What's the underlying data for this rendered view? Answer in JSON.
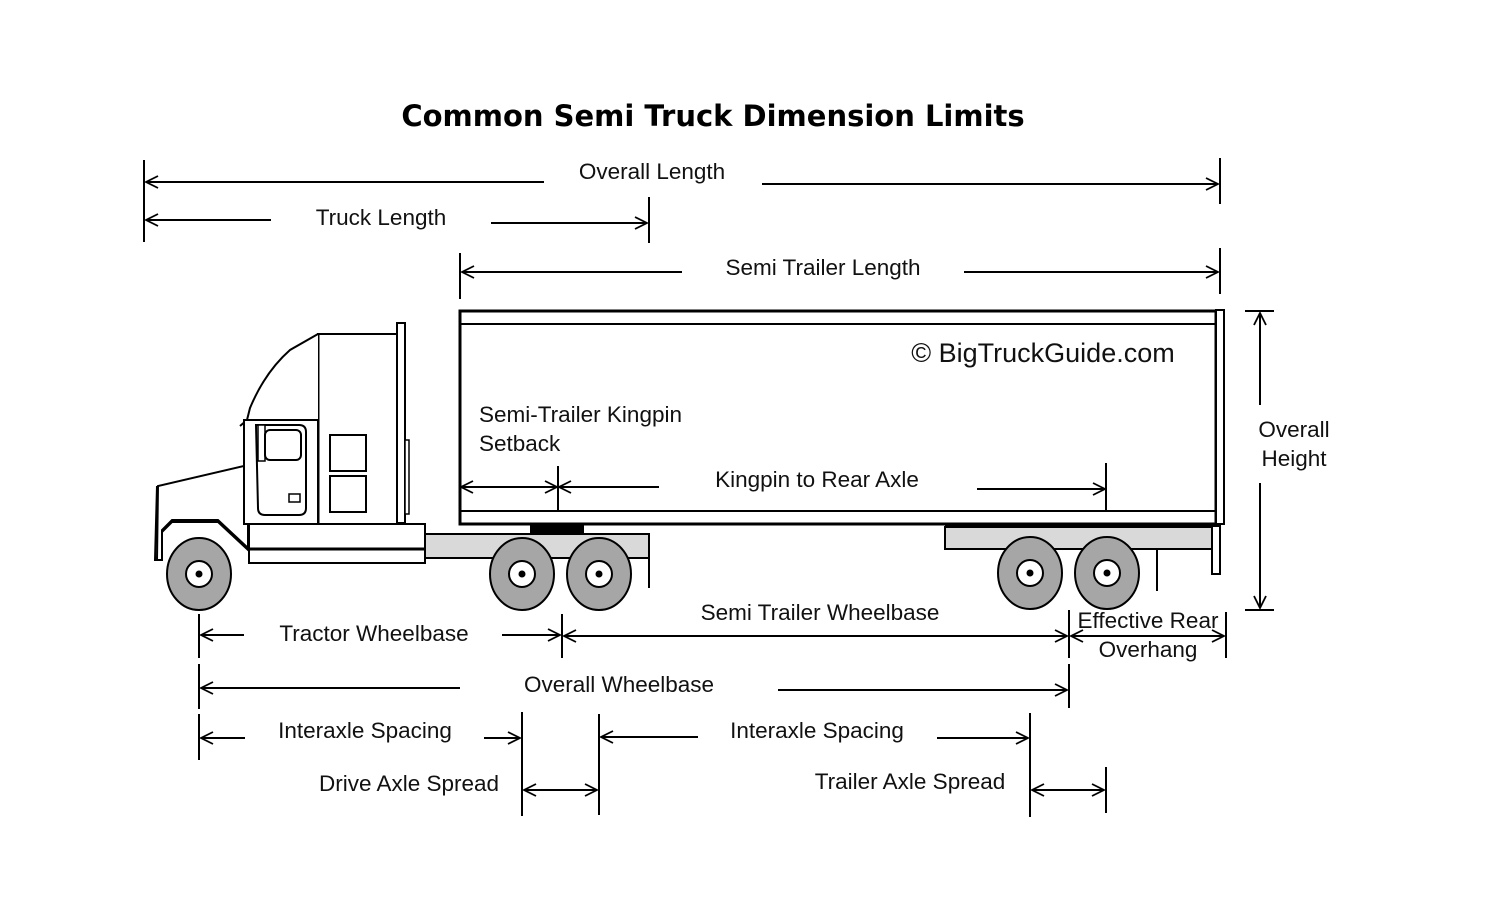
{
  "diagram": {
    "title": "Common Semi Truck Dimension Limits",
    "watermark": "© BigTruckGuide.com",
    "colors": {
      "background": "#ffffff",
      "line": "#000000",
      "tire": "#a6a6a6",
      "frame": "#d9d9d9"
    },
    "dimensions": {
      "overall_length": "Overall Length",
      "truck_length": "Truck Length",
      "semi_trailer_length": "Semi Trailer Length",
      "overall_height_line1": "Overall",
      "overall_height_line2": "Height",
      "kingpin_setback_line1": "Semi-Trailer Kingpin",
      "kingpin_setback_line2": "Setback",
      "kingpin_to_rear_axle": "Kingpin to Rear Axle",
      "tractor_wheelbase": "Tractor Wheelbase",
      "semi_trailer_wheelbase": "Semi Trailer Wheelbase",
      "effective_rear_overhang_line1": "Effective Rear",
      "effective_rear_overhang_line2": "Overhang",
      "overall_wheelbase": "Overall Wheelbase",
      "interaxle_spacing_tractor": "Interaxle Spacing",
      "interaxle_spacing_trailer": "Interaxle Spacing",
      "drive_axle_spread": "Drive Axle Spread",
      "trailer_axle_spread": "Trailer Axle Spread"
    },
    "vehicle_parts": {
      "tractor": "tractor",
      "semi_trailer": "semi-trailer",
      "steer_axle": "steer axle",
      "drive_axles": "drive axles",
      "trailer_axles": "trailer axles"
    }
  }
}
